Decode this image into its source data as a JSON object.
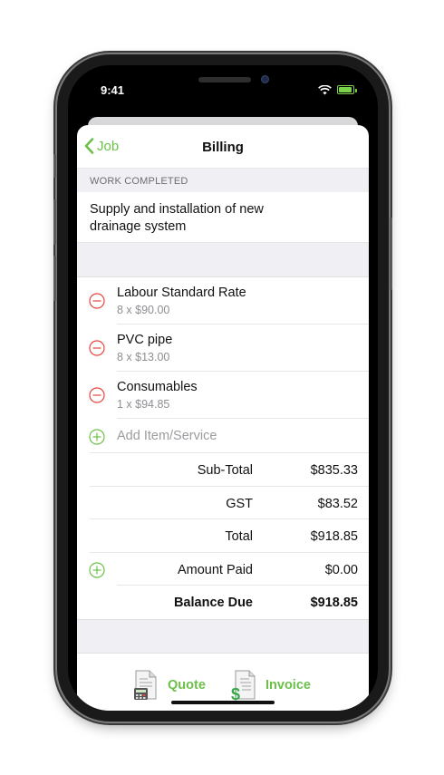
{
  "status": {
    "time": "9:41"
  },
  "nav": {
    "back_label": "Job",
    "title": "Billing"
  },
  "work": {
    "section_header": "WORK COMPLETED",
    "description_line1": "Supply and installation of new",
    "description_line2": "drainage system"
  },
  "items": [
    {
      "name": "Labour Standard Rate",
      "qty": "8 x $90.00"
    },
    {
      "name": "PVC pipe",
      "qty": "8 x $13.00"
    },
    {
      "name": "Consumables",
      "qty": "1 x $94.85"
    }
  ],
  "add_item_label": "Add Item/Service",
  "totals": {
    "subtotal_label": "Sub-Total",
    "subtotal_value": "$835.33",
    "gst_label": "GST",
    "gst_value": "$83.52",
    "total_label": "Total",
    "total_value": "$918.85",
    "paid_label": "Amount Paid",
    "paid_value": "$0.00",
    "balance_label": "Balance Due",
    "balance_value": "$918.85"
  },
  "toolbar": {
    "quote_label": "Quote",
    "invoice_label": "Invoice"
  },
  "colors": {
    "accent": "#6cc04a",
    "remove": "#e5453b",
    "group_bg": "#efeff4"
  }
}
